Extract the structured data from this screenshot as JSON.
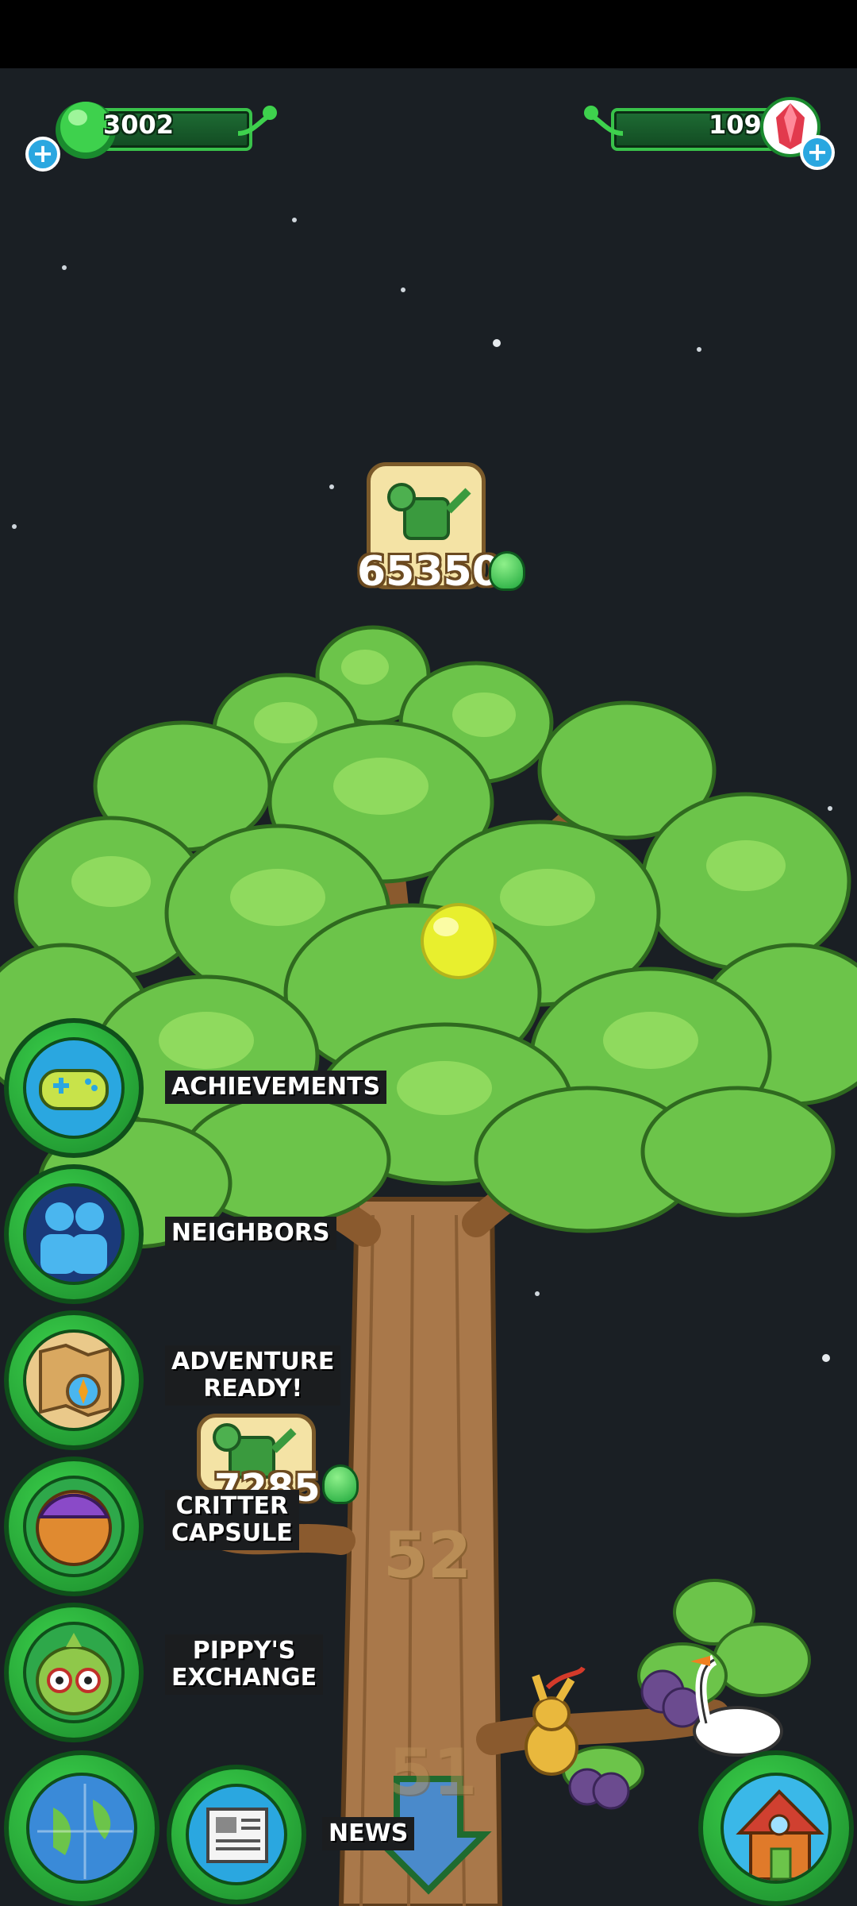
{
  "currencies": {
    "gems_green": "3002",
    "crystals": "109"
  },
  "top_upgrade": {
    "price": "65350"
  },
  "branch_upgrade": {
    "price": "7285"
  },
  "tree": {
    "level_current": "52",
    "level_below": "51"
  },
  "menu": {
    "achievements": "ACHIEVEMENTS",
    "neighbors": "NEIGHBORS",
    "adventure_line1": "ADVENTURE",
    "adventure_line2": "READY!",
    "critter_line1": "CRITTER",
    "critter_line2": "CAPSULE",
    "pippy_line1": "PIPPY'S",
    "pippy_line2": "EXCHANGE",
    "news": "NEWS"
  },
  "colors": {
    "accent_green": "#39c24a",
    "background": "#1a1f24"
  }
}
